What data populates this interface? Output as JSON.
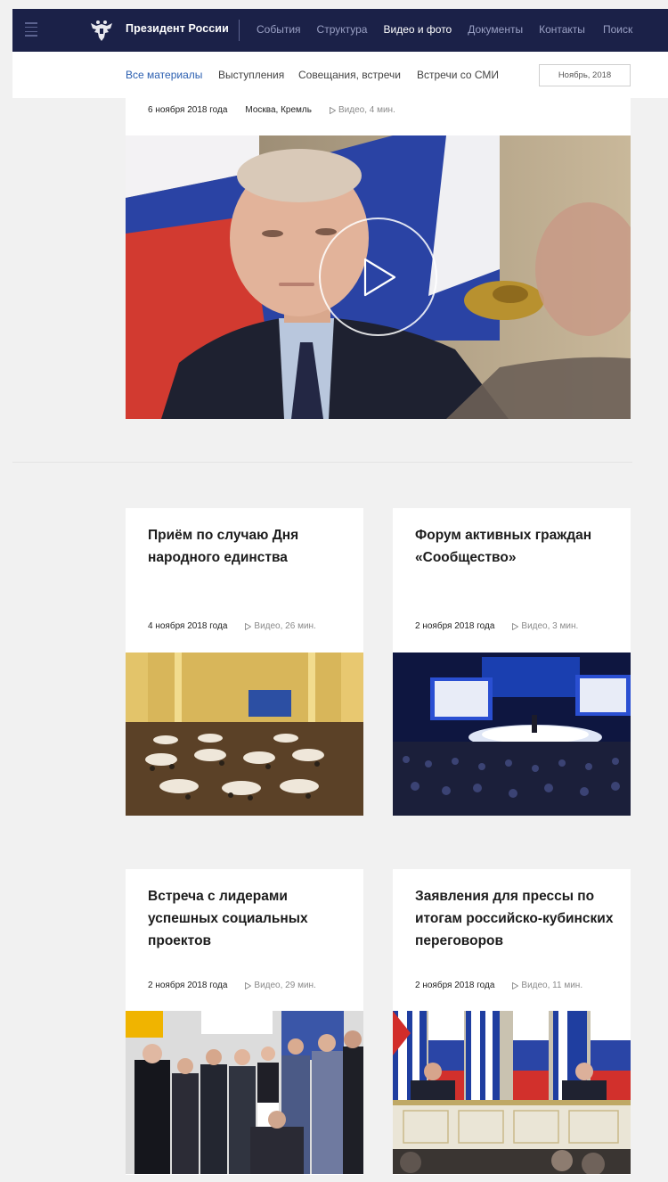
{
  "header": {
    "title": "Президент России",
    "nav": [
      {
        "label": "События",
        "active": false
      },
      {
        "label": "Структура",
        "active": false
      },
      {
        "label": "Видео и фото",
        "active": true
      },
      {
        "label": "Документы",
        "active": false
      },
      {
        "label": "Контакты",
        "active": false
      },
      {
        "label": "Поиск",
        "active": false
      }
    ]
  },
  "subnav": {
    "tabs": [
      {
        "label": "Все материалы",
        "active": true
      },
      {
        "label": "Выступления",
        "active": false
      },
      {
        "label": "Совещания, встречи",
        "active": false
      },
      {
        "label": "Встречи со СМИ",
        "active": false
      }
    ],
    "date_filter": "Ноябрь, 2018"
  },
  "featured": {
    "date": "6 ноября 2018 года",
    "location": "Москва, Кремль",
    "duration": "Видео, 4 мин."
  },
  "cards": [
    {
      "title": "Приём по случаю Дня народного единства",
      "date": "4 ноября 2018 года",
      "duration": "Видео, 26 мин."
    },
    {
      "title": "Форум активных граждан «Сообщество»",
      "date": "2 ноября 2018 года",
      "duration": "Видео, 3 мин."
    },
    {
      "title": "Встреча с лидерами успешных социальных проектов",
      "date": "2 ноября 2018 года",
      "duration": "Видео, 29 мин."
    },
    {
      "title": "Заявления для прессы по итогам российско-кубинских переговоров",
      "date": "2 ноября 2018 года",
      "duration": "Видео, 11 мин."
    }
  ],
  "colors": {
    "header_bg": "#1b2148",
    "active_link": "#2b5fb0",
    "page_bg": "#f1f1f1"
  },
  "icons": {
    "menu": "hamburger-icon",
    "emblem": "double-headed-eagle-icon",
    "play": "play-icon",
    "video": "video-triangle-icon"
  }
}
